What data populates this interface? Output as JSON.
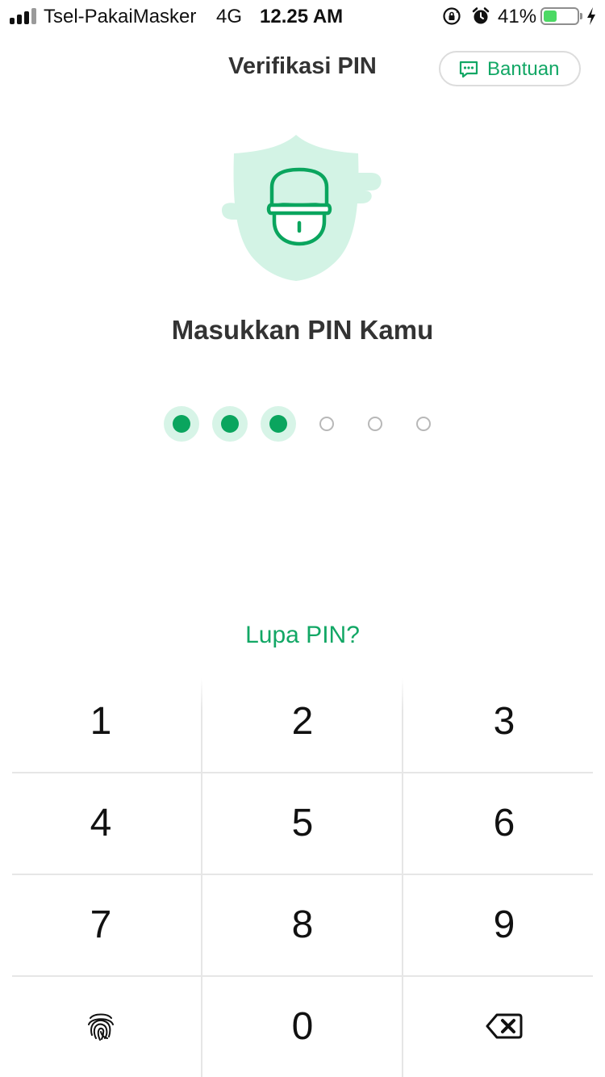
{
  "status_bar": {
    "carrier": "Tsel-PakaiMasker",
    "network": "4G",
    "time": "12.25 AM",
    "battery_percent": "41%",
    "battery_level": 0.41,
    "battery_color": "#4cd964"
  },
  "header": {
    "title": "Verifikasi PIN",
    "help_label": "Bantuan"
  },
  "illustration": {
    "icon": "shield-lock-icon",
    "shield_color": "#d3f3e5",
    "lock_color": "#0aa55e"
  },
  "pin": {
    "heading": "Masukkan PIN Kamu",
    "length": 6,
    "entered": 3
  },
  "forgot_label": "Lupa PIN?",
  "keypad": {
    "keys": [
      "1",
      "2",
      "3",
      "4",
      "5",
      "6",
      "7",
      "8",
      "9",
      "0"
    ],
    "fingerprint_icon": "fingerprint-icon",
    "backspace_icon": "backspace-icon"
  },
  "colors": {
    "accent": "#12a765",
    "accent_dark": "#0aa55e",
    "accent_light": "#d7f4e7"
  }
}
